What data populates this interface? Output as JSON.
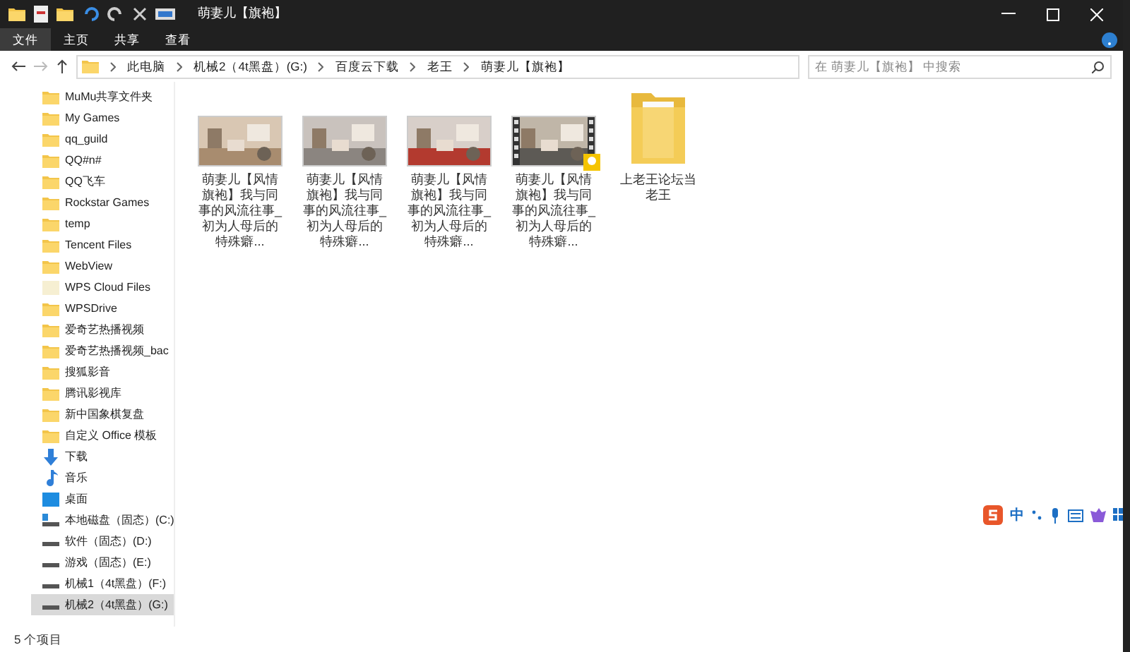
{
  "window": {
    "title": "萌妻儿【旗袍】"
  },
  "ribbon_tabs": [
    {
      "label": "文件",
      "selected": true
    },
    {
      "label": "主页",
      "selected": false
    },
    {
      "label": "共享",
      "selected": false
    },
    {
      "label": "查看",
      "selected": false
    }
  ],
  "address": {
    "crumbs": [
      "此电脑",
      "机械2（4t黑盘）(G:)",
      "百度云下载",
      "老王",
      "萌妻儿【旗袍】"
    ]
  },
  "search": {
    "placeholder": "在 萌妻儿【旗袍】 中搜索"
  },
  "sidebar": {
    "items": [
      {
        "kind": "folder",
        "label": "MuMu共享文件夹",
        "selected": false
      },
      {
        "kind": "folder",
        "label": "My Games",
        "selected": false
      },
      {
        "kind": "folder",
        "label": "qq_guild",
        "selected": false
      },
      {
        "kind": "folder",
        "label": "QQ#n#",
        "selected": false
      },
      {
        "kind": "folder",
        "label": "QQ飞车",
        "selected": false
      },
      {
        "kind": "folder",
        "label": "Rockstar Games",
        "selected": false
      },
      {
        "kind": "folder",
        "label": "temp",
        "selected": false
      },
      {
        "kind": "folder",
        "label": "Tencent Files",
        "selected": false
      },
      {
        "kind": "folder",
        "label": "WebView",
        "selected": false
      },
      {
        "kind": "cloud",
        "label": "WPS Cloud Files",
        "selected": false
      },
      {
        "kind": "folder",
        "label": "WPSDrive",
        "selected": false
      },
      {
        "kind": "folder",
        "label": "爱奇艺热播视频",
        "selected": false
      },
      {
        "kind": "folder",
        "label": "爱奇艺热播视频_bac",
        "selected": false
      },
      {
        "kind": "folder",
        "label": "搜狐影音",
        "selected": false
      },
      {
        "kind": "folder",
        "label": "腾讯影视库",
        "selected": false
      },
      {
        "kind": "folder",
        "label": "新中国象棋复盘",
        "selected": false
      },
      {
        "kind": "folder",
        "label": "自定义 Office 模板",
        "selected": false
      },
      {
        "kind": "download",
        "label": "下载",
        "selected": false
      },
      {
        "kind": "music",
        "label": "音乐",
        "selected": false
      },
      {
        "kind": "desktop",
        "label": "桌面",
        "selected": false
      },
      {
        "kind": "system",
        "label": "本地磁盘（固态）(C:)",
        "selected": false
      },
      {
        "kind": "drive",
        "label": "软件（固态）(D:)",
        "selected": false
      },
      {
        "kind": "drive",
        "label": "游戏（固态）(E:)",
        "selected": false
      },
      {
        "kind": "drive",
        "label": "机械1（4t黑盘）(F:)",
        "selected": false
      },
      {
        "kind": "drive",
        "label": "机械2（4t黑盘）(G:)",
        "selected": true
      }
    ]
  },
  "files": [
    {
      "kind": "video",
      "name": "萌妻儿【风情旗袍】我与同事的风流往事_初为人母后的特殊癖...",
      "film_strip": false
    },
    {
      "kind": "video",
      "name": "萌妻儿【风情旗袍】我与同事的风流往事_初为人母后的特殊癖...",
      "film_strip": false
    },
    {
      "kind": "video",
      "name": "萌妻儿【风情旗袍】我与同事的风流往事_初为人母后的特殊癖...",
      "film_strip": false
    },
    {
      "kind": "video",
      "name": "萌妻儿【风情旗袍】我与同事的风流往事_初为人母后的特殊癖...",
      "film_strip": true
    },
    {
      "kind": "folder",
      "name": "上老王论坛当老王"
    }
  ],
  "status_bar": {
    "count": "5 个项目"
  },
  "ime": {
    "mode": "中"
  }
}
